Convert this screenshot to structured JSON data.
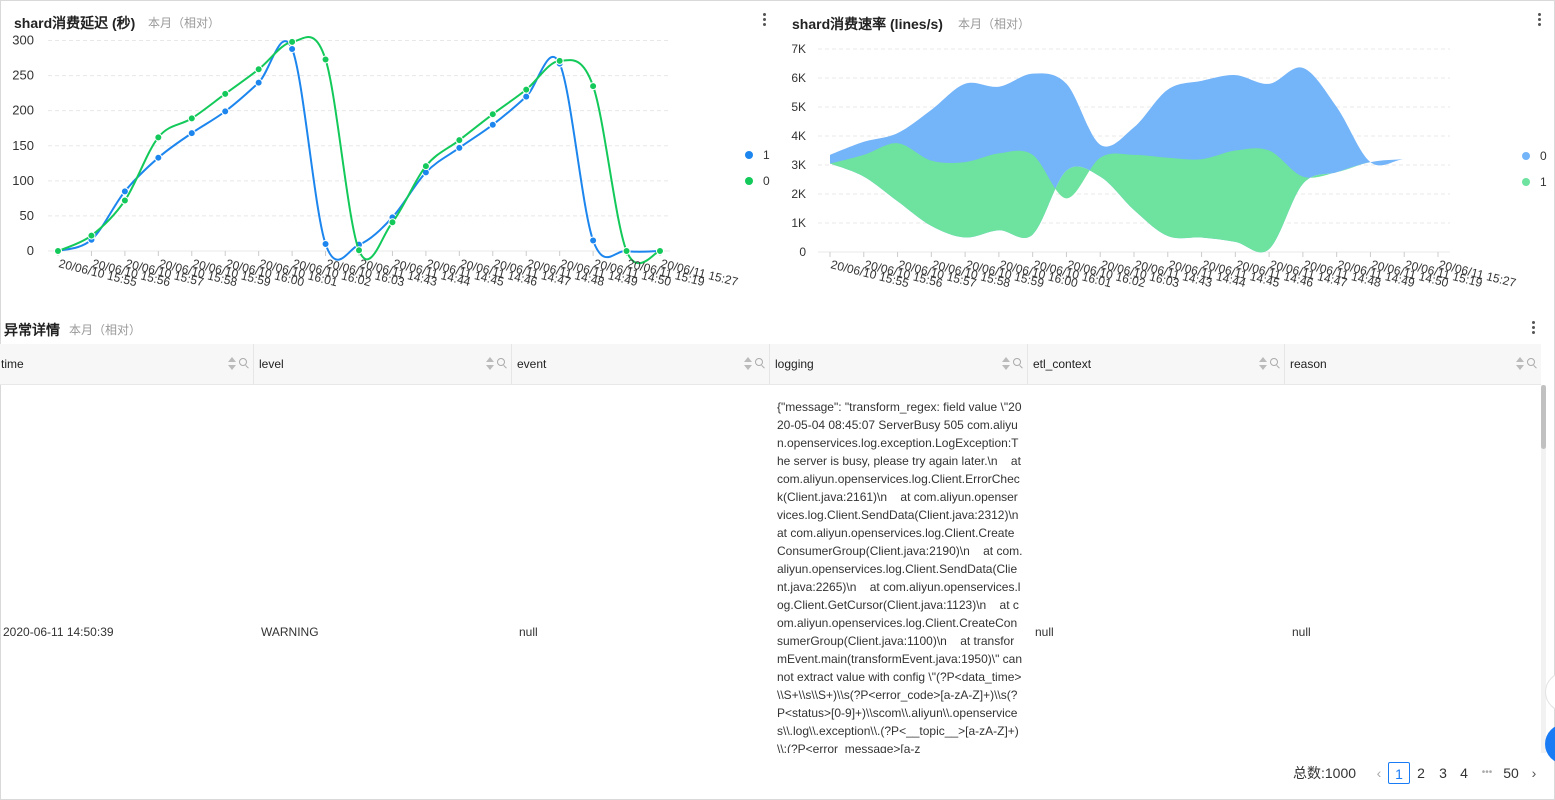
{
  "panels": {
    "latency": {
      "title": "shard消费延迟 (秒)",
      "subtitle": "本月（相对）"
    },
    "rate": {
      "title": "shard消费速率 (lines/s)",
      "subtitle": "本月（相对）"
    },
    "details": {
      "title": "异常详情",
      "subtitle": "本月（相对）"
    }
  },
  "chart_data": [
    {
      "type": "line",
      "title": "shard消费延迟 (秒)",
      "categories": [
        "20/06/10 15:55",
        "20/06/10 15:56",
        "20/06/10 15:57",
        "20/06/10 15:58",
        "20/06/10 15:59",
        "20/06/10 16:00",
        "20/06/10 16:01",
        "20/06/10 16:02",
        "20/06/10 16:03",
        "20/06/11 14:43",
        "20/06/11 14:44",
        "20/06/11 14:45",
        "20/06/11 14:46",
        "20/06/11 14:47",
        "20/06/11 14:48",
        "20/06/11 14:49",
        "20/06/11 14:50",
        "20/06/11 15:19",
        "20/06/11 15:27"
      ],
      "series": [
        {
          "name": "1",
          "color": "#1c86ee",
          "values": [
            0,
            16,
            85,
            133,
            168,
            199,
            240,
            288,
            10,
            9,
            48,
            112,
            147,
            180,
            220,
            267,
            15,
            0,
            0
          ]
        },
        {
          "name": "0",
          "color": "#13c95a",
          "values": [
            0,
            22,
            72,
            162,
            189,
            224,
            259,
            298,
            273,
            1,
            41,
            121,
            158,
            195,
            230,
            271,
            235,
            0,
            0
          ]
        }
      ],
      "yticks": [
        0,
        50,
        100,
        150,
        200,
        250,
        300
      ],
      "ylim": [
        0,
        315
      ],
      "grid": true,
      "legend": "right"
    },
    {
      "type": "area",
      "title": "shard消费速率 (lines/s)",
      "stacked": "streamgraph",
      "categories": [
        "20/06/10 15:55",
        "20/06/10 15:56",
        "20/06/10 15:57",
        "20/06/10 15:58",
        "20/06/10 15:59",
        "20/06/10 16:00",
        "20/06/10 16:01",
        "20/06/10 16:02",
        "20/06/10 16:03",
        "20/06/11 14:43",
        "20/06/11 14:44",
        "20/06/11 14:45",
        "20/06/11 14:46",
        "20/06/11 14:47",
        "20/06/11 14:48",
        "20/06/11 14:49",
        "20/06/11 14:50",
        "20/06/11 15:19",
        "20/06/11 15:27"
      ],
      "series": [
        {
          "name": "0",
          "color": "#74b4f9",
          "upper": [
            3350,
            3800,
            4100,
            4900,
            5800,
            5700,
            6150,
            5800,
            3700,
            4300,
            5600,
            5900,
            6100,
            5800,
            6350,
            5000,
            3100,
            3200,
            3200
          ]
        },
        {
          "name": "1",
          "color": "#6ee29f",
          "upper": [
            3050,
            3350,
            3750,
            3150,
            3100,
            3400,
            3350,
            1850,
            3250,
            3350,
            3250,
            3200,
            3500,
            3500,
            2600,
            2750,
            3100,
            3200,
            3200
          ],
          "lower": [
            3050,
            2600,
            1750,
            900,
            500,
            750,
            600,
            2800,
            2600,
            1450,
            550,
            500,
            350,
            100,
            2350,
            2750,
            3100,
            3200,
            3200
          ]
        }
      ],
      "yticks": [
        "0",
        "1K",
        "2K",
        "3K",
        "4K",
        "5K",
        "6K",
        "7K"
      ],
      "ylim": [
        0,
        7000
      ],
      "grid": true,
      "legend": "right"
    }
  ],
  "table": {
    "columns": [
      {
        "key": "time",
        "label": "time"
      },
      {
        "key": "level",
        "label": "level"
      },
      {
        "key": "event",
        "label": "event"
      },
      {
        "key": "logging",
        "label": "logging"
      },
      {
        "key": "etl_context",
        "label": "etl_context"
      },
      {
        "key": "reason",
        "label": "reason"
      }
    ],
    "rows": [
      {
        "time": "2020-06-11 14:50:39",
        "level": "WARNING",
        "event": "null",
        "logging": "{\"message\": \"transform_regex: field value \\\"2020-05-04 08:45:07 ServerBusy 505 com.aliyun.openservices.log.exception.LogException:The server is busy, please try again later.\\n    at com.aliyun.openservices.log.Client.ErrorCheck(Client.java:2161)\\n    at com.aliyun.openservices.log.Client.SendData(Client.java:2312)\\n    at com.aliyun.openservices.log.Client.CreateConsumerGroup(Client.java:2190)\\n    at com.aliyun.openservices.log.Client.SendData(Client.java:2265)\\n    at com.aliyun.openservices.log.Client.GetCursor(Client.java:1123)\\n    at com.aliyun.openservices.log.Client.CreateConsumerGroup(Client.java:1100)\\n    at transformEvent.main(transformEvent.java:1950)\\\" cannot extract value with config \\\"(?P<data_time>\\\\S+\\\\s\\\\S+)\\\\s(?P<error_code>[a-zA-Z]+)\\\\s(?P<status>[0-9]+)\\\\scom\\\\.aliyun\\\\.openservices\\\\.log\\\\.exception\\\\.(?P<__topic__>[a-zA-Z]+)\\\\:(?P<error_message>[a-z",
        "etl_context": "null",
        "reason": "null"
      }
    ]
  },
  "pagination": {
    "total_label": "总数:1000",
    "pages": [
      "1",
      "2",
      "3",
      "4"
    ],
    "ellipsis": "•••",
    "last_page": "50",
    "prev": "‹",
    "next": "›"
  }
}
